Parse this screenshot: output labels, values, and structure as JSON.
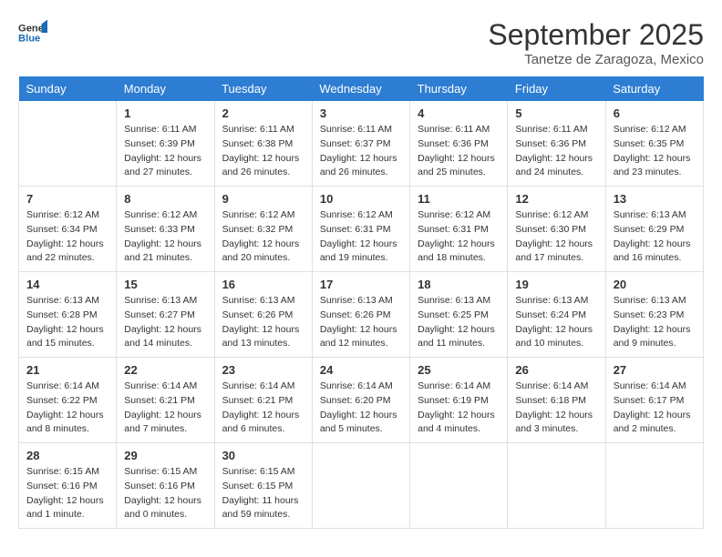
{
  "header": {
    "logo_general": "General",
    "logo_blue": "Blue",
    "title": "September 2025",
    "subtitle": "Tanetze de Zaragoza, Mexico"
  },
  "weekdays": [
    "Sunday",
    "Monday",
    "Tuesday",
    "Wednesday",
    "Thursday",
    "Friday",
    "Saturday"
  ],
  "weeks": [
    [
      {
        "day": "",
        "sunrise": "",
        "sunset": "",
        "daylight": ""
      },
      {
        "day": "1",
        "sunrise": "Sunrise: 6:11 AM",
        "sunset": "Sunset: 6:39 PM",
        "daylight": "Daylight: 12 hours and 27 minutes."
      },
      {
        "day": "2",
        "sunrise": "Sunrise: 6:11 AM",
        "sunset": "Sunset: 6:38 PM",
        "daylight": "Daylight: 12 hours and 26 minutes."
      },
      {
        "day": "3",
        "sunrise": "Sunrise: 6:11 AM",
        "sunset": "Sunset: 6:37 PM",
        "daylight": "Daylight: 12 hours and 26 minutes."
      },
      {
        "day": "4",
        "sunrise": "Sunrise: 6:11 AM",
        "sunset": "Sunset: 6:36 PM",
        "daylight": "Daylight: 12 hours and 25 minutes."
      },
      {
        "day": "5",
        "sunrise": "Sunrise: 6:11 AM",
        "sunset": "Sunset: 6:36 PM",
        "daylight": "Daylight: 12 hours and 24 minutes."
      },
      {
        "day": "6",
        "sunrise": "Sunrise: 6:12 AM",
        "sunset": "Sunset: 6:35 PM",
        "daylight": "Daylight: 12 hours and 23 minutes."
      }
    ],
    [
      {
        "day": "7",
        "sunrise": "Sunrise: 6:12 AM",
        "sunset": "Sunset: 6:34 PM",
        "daylight": "Daylight: 12 hours and 22 minutes."
      },
      {
        "day": "8",
        "sunrise": "Sunrise: 6:12 AM",
        "sunset": "Sunset: 6:33 PM",
        "daylight": "Daylight: 12 hours and 21 minutes."
      },
      {
        "day": "9",
        "sunrise": "Sunrise: 6:12 AM",
        "sunset": "Sunset: 6:32 PM",
        "daylight": "Daylight: 12 hours and 20 minutes."
      },
      {
        "day": "10",
        "sunrise": "Sunrise: 6:12 AM",
        "sunset": "Sunset: 6:31 PM",
        "daylight": "Daylight: 12 hours and 19 minutes."
      },
      {
        "day": "11",
        "sunrise": "Sunrise: 6:12 AM",
        "sunset": "Sunset: 6:31 PM",
        "daylight": "Daylight: 12 hours and 18 minutes."
      },
      {
        "day": "12",
        "sunrise": "Sunrise: 6:12 AM",
        "sunset": "Sunset: 6:30 PM",
        "daylight": "Daylight: 12 hours and 17 minutes."
      },
      {
        "day": "13",
        "sunrise": "Sunrise: 6:13 AM",
        "sunset": "Sunset: 6:29 PM",
        "daylight": "Daylight: 12 hours and 16 minutes."
      }
    ],
    [
      {
        "day": "14",
        "sunrise": "Sunrise: 6:13 AM",
        "sunset": "Sunset: 6:28 PM",
        "daylight": "Daylight: 12 hours and 15 minutes."
      },
      {
        "day": "15",
        "sunrise": "Sunrise: 6:13 AM",
        "sunset": "Sunset: 6:27 PM",
        "daylight": "Daylight: 12 hours and 14 minutes."
      },
      {
        "day": "16",
        "sunrise": "Sunrise: 6:13 AM",
        "sunset": "Sunset: 6:26 PM",
        "daylight": "Daylight: 12 hours and 13 minutes."
      },
      {
        "day": "17",
        "sunrise": "Sunrise: 6:13 AM",
        "sunset": "Sunset: 6:26 PM",
        "daylight": "Daylight: 12 hours and 12 minutes."
      },
      {
        "day": "18",
        "sunrise": "Sunrise: 6:13 AM",
        "sunset": "Sunset: 6:25 PM",
        "daylight": "Daylight: 12 hours and 11 minutes."
      },
      {
        "day": "19",
        "sunrise": "Sunrise: 6:13 AM",
        "sunset": "Sunset: 6:24 PM",
        "daylight": "Daylight: 12 hours and 10 minutes."
      },
      {
        "day": "20",
        "sunrise": "Sunrise: 6:13 AM",
        "sunset": "Sunset: 6:23 PM",
        "daylight": "Daylight: 12 hours and 9 minutes."
      }
    ],
    [
      {
        "day": "21",
        "sunrise": "Sunrise: 6:14 AM",
        "sunset": "Sunset: 6:22 PM",
        "daylight": "Daylight: 12 hours and 8 minutes."
      },
      {
        "day": "22",
        "sunrise": "Sunrise: 6:14 AM",
        "sunset": "Sunset: 6:21 PM",
        "daylight": "Daylight: 12 hours and 7 minutes."
      },
      {
        "day": "23",
        "sunrise": "Sunrise: 6:14 AM",
        "sunset": "Sunset: 6:21 PM",
        "daylight": "Daylight: 12 hours and 6 minutes."
      },
      {
        "day": "24",
        "sunrise": "Sunrise: 6:14 AM",
        "sunset": "Sunset: 6:20 PM",
        "daylight": "Daylight: 12 hours and 5 minutes."
      },
      {
        "day": "25",
        "sunrise": "Sunrise: 6:14 AM",
        "sunset": "Sunset: 6:19 PM",
        "daylight": "Daylight: 12 hours and 4 minutes."
      },
      {
        "day": "26",
        "sunrise": "Sunrise: 6:14 AM",
        "sunset": "Sunset: 6:18 PM",
        "daylight": "Daylight: 12 hours and 3 minutes."
      },
      {
        "day": "27",
        "sunrise": "Sunrise: 6:14 AM",
        "sunset": "Sunset: 6:17 PM",
        "daylight": "Daylight: 12 hours and 2 minutes."
      }
    ],
    [
      {
        "day": "28",
        "sunrise": "Sunrise: 6:15 AM",
        "sunset": "Sunset: 6:16 PM",
        "daylight": "Daylight: 12 hours and 1 minute."
      },
      {
        "day": "29",
        "sunrise": "Sunrise: 6:15 AM",
        "sunset": "Sunset: 6:16 PM",
        "daylight": "Daylight: 12 hours and 0 minutes."
      },
      {
        "day": "30",
        "sunrise": "Sunrise: 6:15 AM",
        "sunset": "Sunset: 6:15 PM",
        "daylight": "Daylight: 11 hours and 59 minutes."
      },
      {
        "day": "",
        "sunrise": "",
        "sunset": "",
        "daylight": ""
      },
      {
        "day": "",
        "sunrise": "",
        "sunset": "",
        "daylight": ""
      },
      {
        "day": "",
        "sunrise": "",
        "sunset": "",
        "daylight": ""
      },
      {
        "day": "",
        "sunrise": "",
        "sunset": "",
        "daylight": ""
      }
    ]
  ]
}
